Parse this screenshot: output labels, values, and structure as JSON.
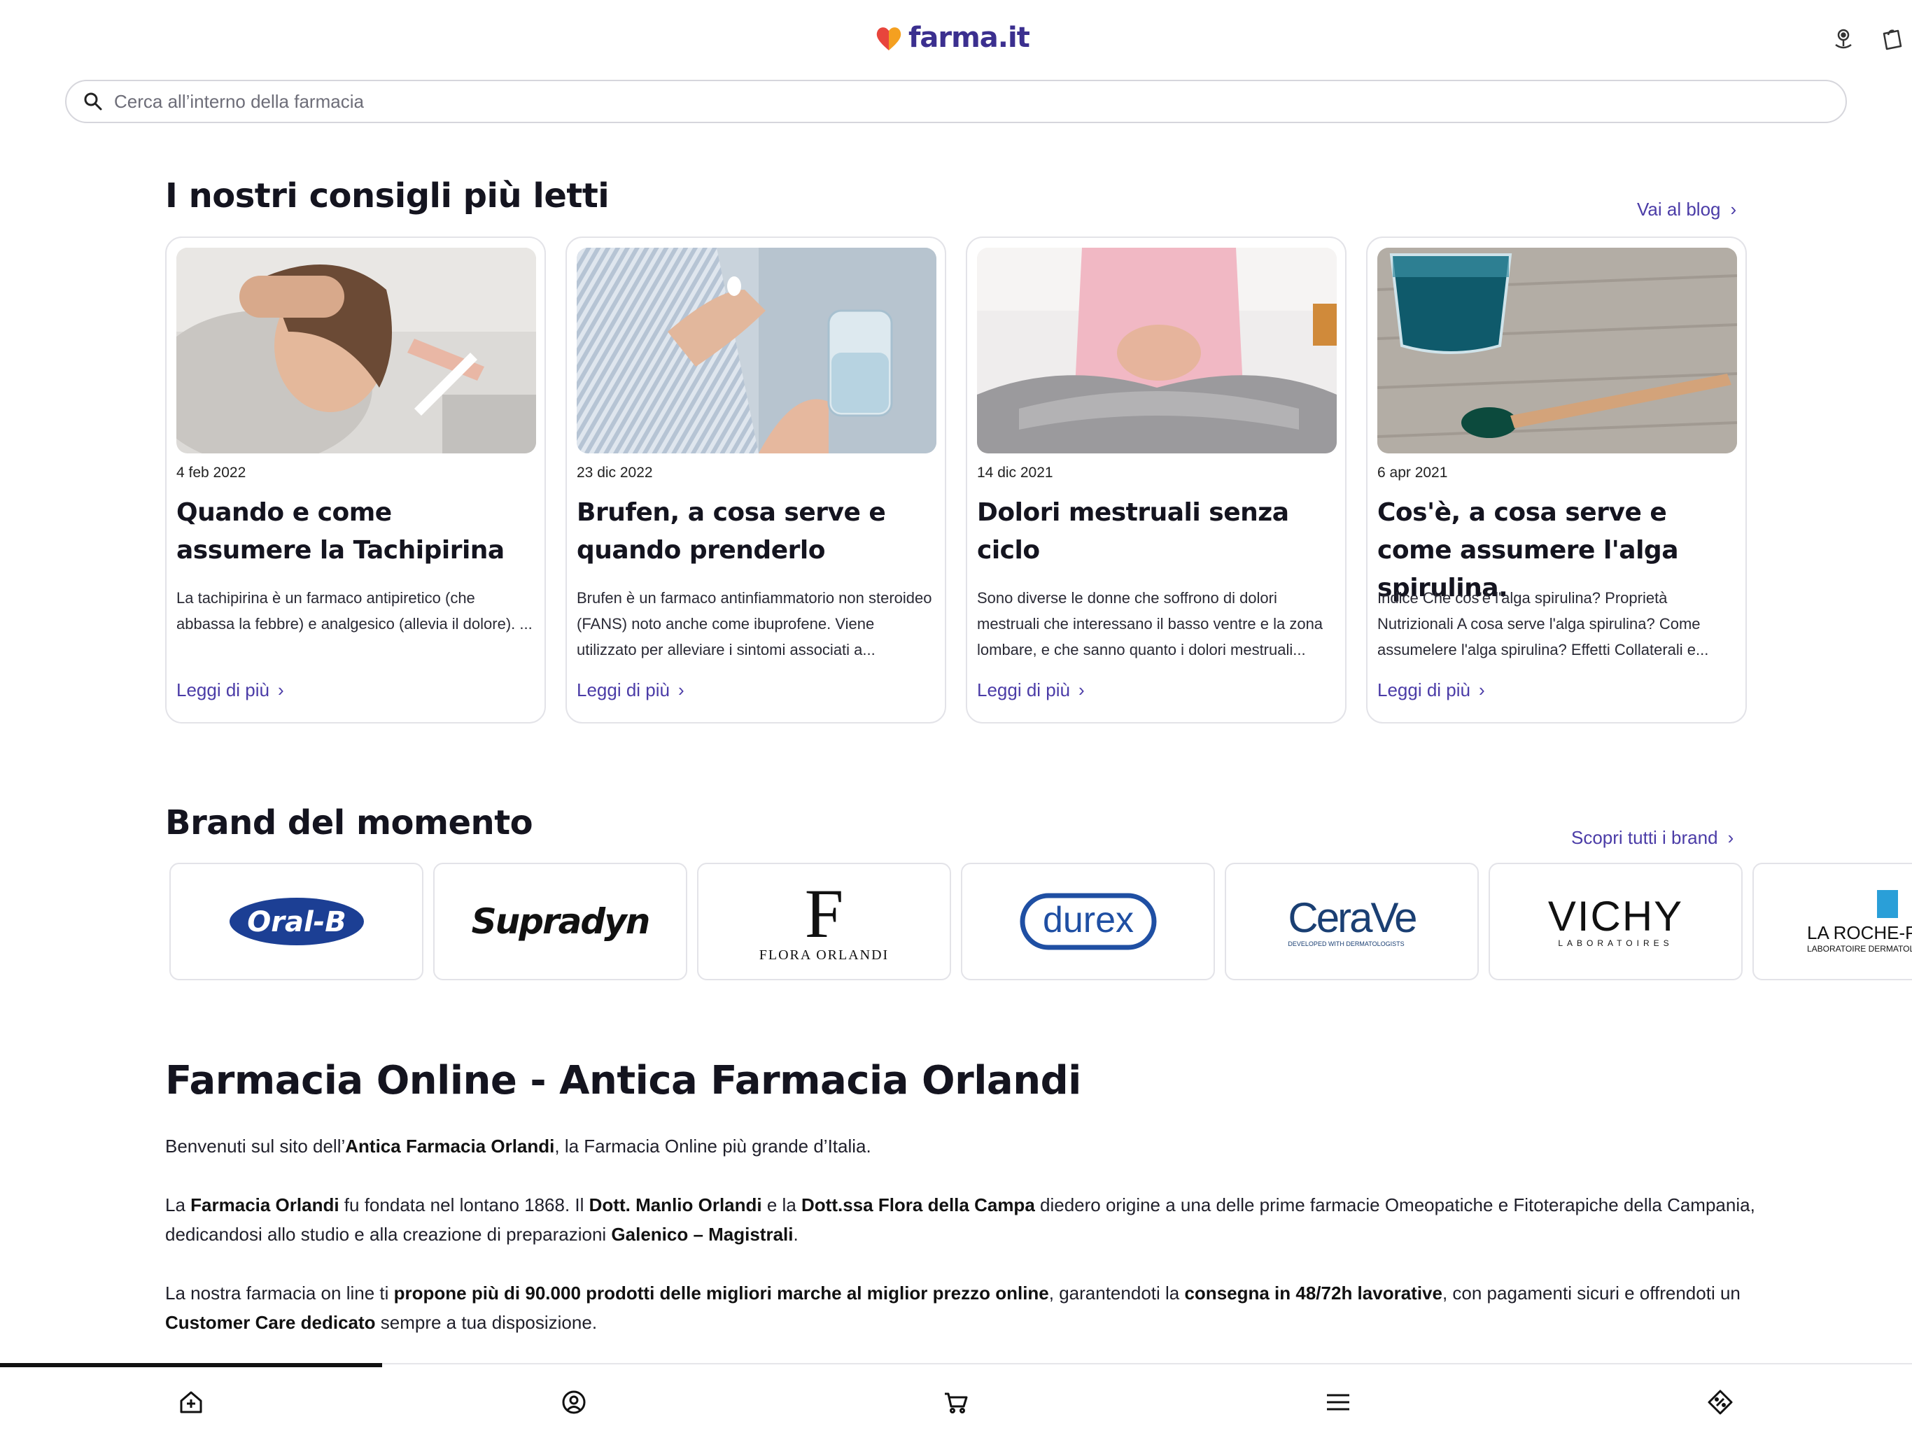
{
  "header": {
    "logo_text": "farma",
    "logo_suffix": ".it",
    "search_placeholder": "Cerca all’interno della farmacia"
  },
  "blog": {
    "title": "I nostri consigli più letti",
    "link_label": "Vai al blog",
    "read_more": "Leggi di più",
    "cards": [
      {
        "date": "4 feb 2022",
        "title": "Quando e come assumere la Tachipirina",
        "excerpt": "La tachipirina è un farmaco antipiretico (che abbassa la febbre) e analgesico (allevia il dolore). ..."
      },
      {
        "date": "23 dic 2022",
        "title": "Brufen, a cosa serve e quando prenderlo",
        "excerpt": "Brufen è un farmaco antinfiammatorio non steroideo (FANS) noto anche come ibuprofene. Viene utilizzato per alleviare i sintomi associati a..."
      },
      {
        "date": "14 dic 2021",
        "title": "Dolori mestruali senza ciclo",
        "excerpt": "Sono diverse le donne che soffrono di dolori mestruali che interessano il basso ventre e la zona lombare, e che sanno quanto i dolori mestruali..."
      },
      {
        "date": "6 apr 2021",
        "title": "Cos'è, a cosa serve e come assumere l'alga spirulina.",
        "excerpt": "Indice Che cos'è l'alga spirulina? Proprietà Nutrizionali A cosa serve l'alga spirulina? Come assumelere l'alga spirulina? Effetti Collaterali e..."
      }
    ]
  },
  "brands": {
    "title": "Brand del momento",
    "link_label": "Scopri tutti i brand",
    "items": [
      "Oral-B",
      "Supradyn",
      "FLORA ORLANDI",
      "durex",
      "CeraVe",
      "VICHY",
      "LA ROCHE-POSAY"
    ],
    "cerave_tagline": "DEVELOPED WITH DERMATOLOGISTS",
    "vichy_tagline": "LABORATOIRES",
    "laroche_tagline": "LABORATOIRE DERMATOLOGIQUE"
  },
  "about": {
    "title": "Farmacia Online - Antica Farmacia Orlandi",
    "p1": {
      "a": "Benvenuti sul sito dell’",
      "b": "Antica Farmacia Orlandi",
      "c": ", la Farmacia Online più grande d’Italia."
    },
    "p2": {
      "a": "La ",
      "b": "Farmacia Orlandi",
      "c": " fu fondata nel lontano 1868. Il ",
      "d": "Dott. Manlio Orlandi",
      "e": " e la ",
      "f": "Dott.ssa Flora della Campa",
      "g": " diedero origine a una delle prime farmacie Omeopatiche e Fitoterapiche della Campania, dedicandosi allo studio e alla creazione di preparazioni ",
      "h": "Galenico – Magistrali",
      "i": "."
    },
    "p3": {
      "a": "La nostra farmacia on line ti ",
      "b": "propone più di 90.000 prodotti delle migliori marche al miglior prezzo online",
      "c": ", garantendoti la ",
      "d": "consegna in 48/72h lavorative",
      "e": ", con pagamenti sicuri e offrendoti un ",
      "f": "Customer Care dedicato",
      "g": " sempre a tua disposizione."
    }
  },
  "bottom_nav": {
    "items": [
      "home-icon",
      "account-icon",
      "cart-icon",
      "menu-icon",
      "offers-icon"
    ],
    "active_index": 0
  },
  "colors": {
    "accent": "#4b3ca7",
    "logo_heart_orange": "#f4a020",
    "logo_heart_red": "#e8453c",
    "oralb_blue": "#1c3f94",
    "durex_blue": "#1f4fa3",
    "cerave_blue": "#2a6fb5"
  }
}
